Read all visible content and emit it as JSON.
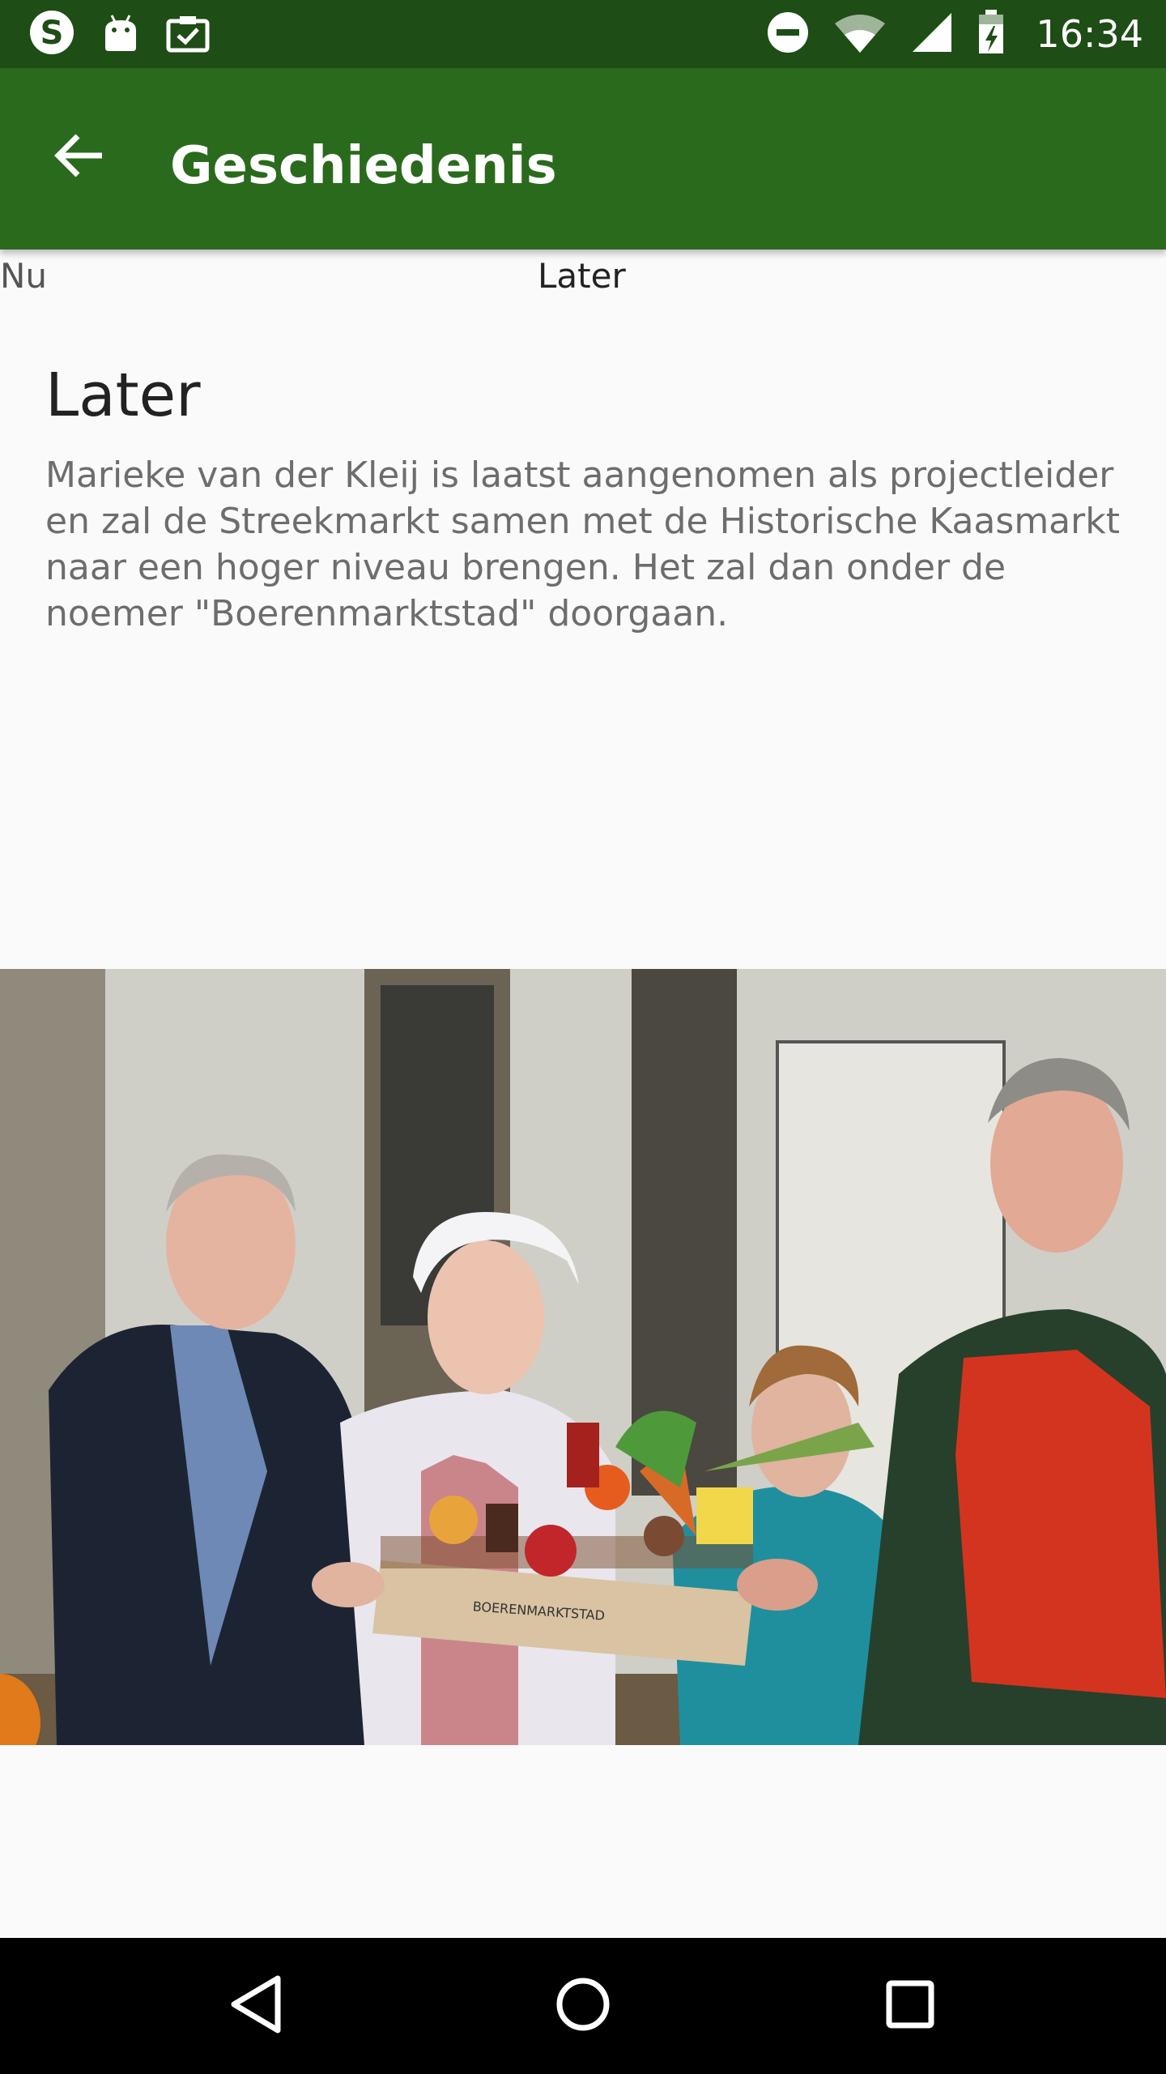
{
  "statusbar": {
    "time": "16:34",
    "icons": [
      "skype-icon",
      "android-icon",
      "clipboard-check-icon",
      "do-not-disturb-icon",
      "wifi-icon",
      "signal-icon",
      "battery-icon"
    ]
  },
  "toolbar": {
    "title": "Geschiedenis",
    "color": "#2a6a1c"
  },
  "tabs": [
    {
      "label": "Nu"
    },
    {
      "label": "Later"
    }
  ],
  "content": {
    "heading": "Later",
    "body": "Marieke van der Kleij is laatst aangenomen als projectleider en zal de Streekmarkt samen met de Historische Kaasmarkt naar een hoger niveau brengen. Het zal dan onder de noemer \"Boerenmarktstad\" doorgaan."
  },
  "photo": {
    "crate_text": "BOERENMARKTSTAD"
  }
}
